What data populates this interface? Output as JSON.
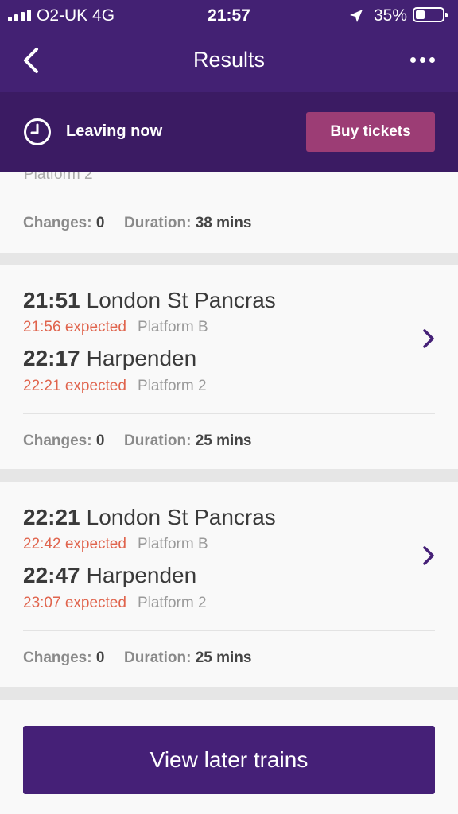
{
  "status": {
    "carrier": "O2-UK  4G",
    "time": "21:57",
    "battery": "35%",
    "battery_level": 0.35
  },
  "nav": {
    "title": "Results",
    "back_icon": "chevron-left-icon",
    "more_icon": "more-horizontal-icon"
  },
  "subbar": {
    "leaving": "Leaving now",
    "buy": "Buy tickets"
  },
  "partial_card": {
    "partial_text": "Platform 2",
    "changes_label": "Changes:",
    "changes": "0",
    "duration_label": "Duration:",
    "duration": "38 mins"
  },
  "journeys": [
    {
      "dep_time": "21:51",
      "dep_station": "London St Pancras",
      "dep_expected": "21:56 expected",
      "dep_platform": "Platform B",
      "arr_time": "22:17",
      "arr_station": "Harpenden",
      "arr_expected": "22:21 expected",
      "arr_platform": "Platform 2",
      "changes_label": "Changes:",
      "changes": "0",
      "duration_label": "Duration:",
      "duration": "25 mins"
    },
    {
      "dep_time": "22:21",
      "dep_station": "London St Pancras",
      "dep_expected": "22:42 expected",
      "dep_platform": "Platform B",
      "arr_time": "22:47",
      "arr_station": "Harpenden",
      "arr_expected": "23:07 expected",
      "arr_platform": "Platform 2",
      "changes_label": "Changes:",
      "changes": "0",
      "duration_label": "Duration:",
      "duration": "25 mins"
    }
  ],
  "footer": {
    "view_later": "View later trains"
  },
  "colors": {
    "header": "#432173",
    "subbar": "#3b1b63",
    "buy_button": "#9c3d75",
    "expected": "#e0644d",
    "primary_button": "#452077"
  }
}
